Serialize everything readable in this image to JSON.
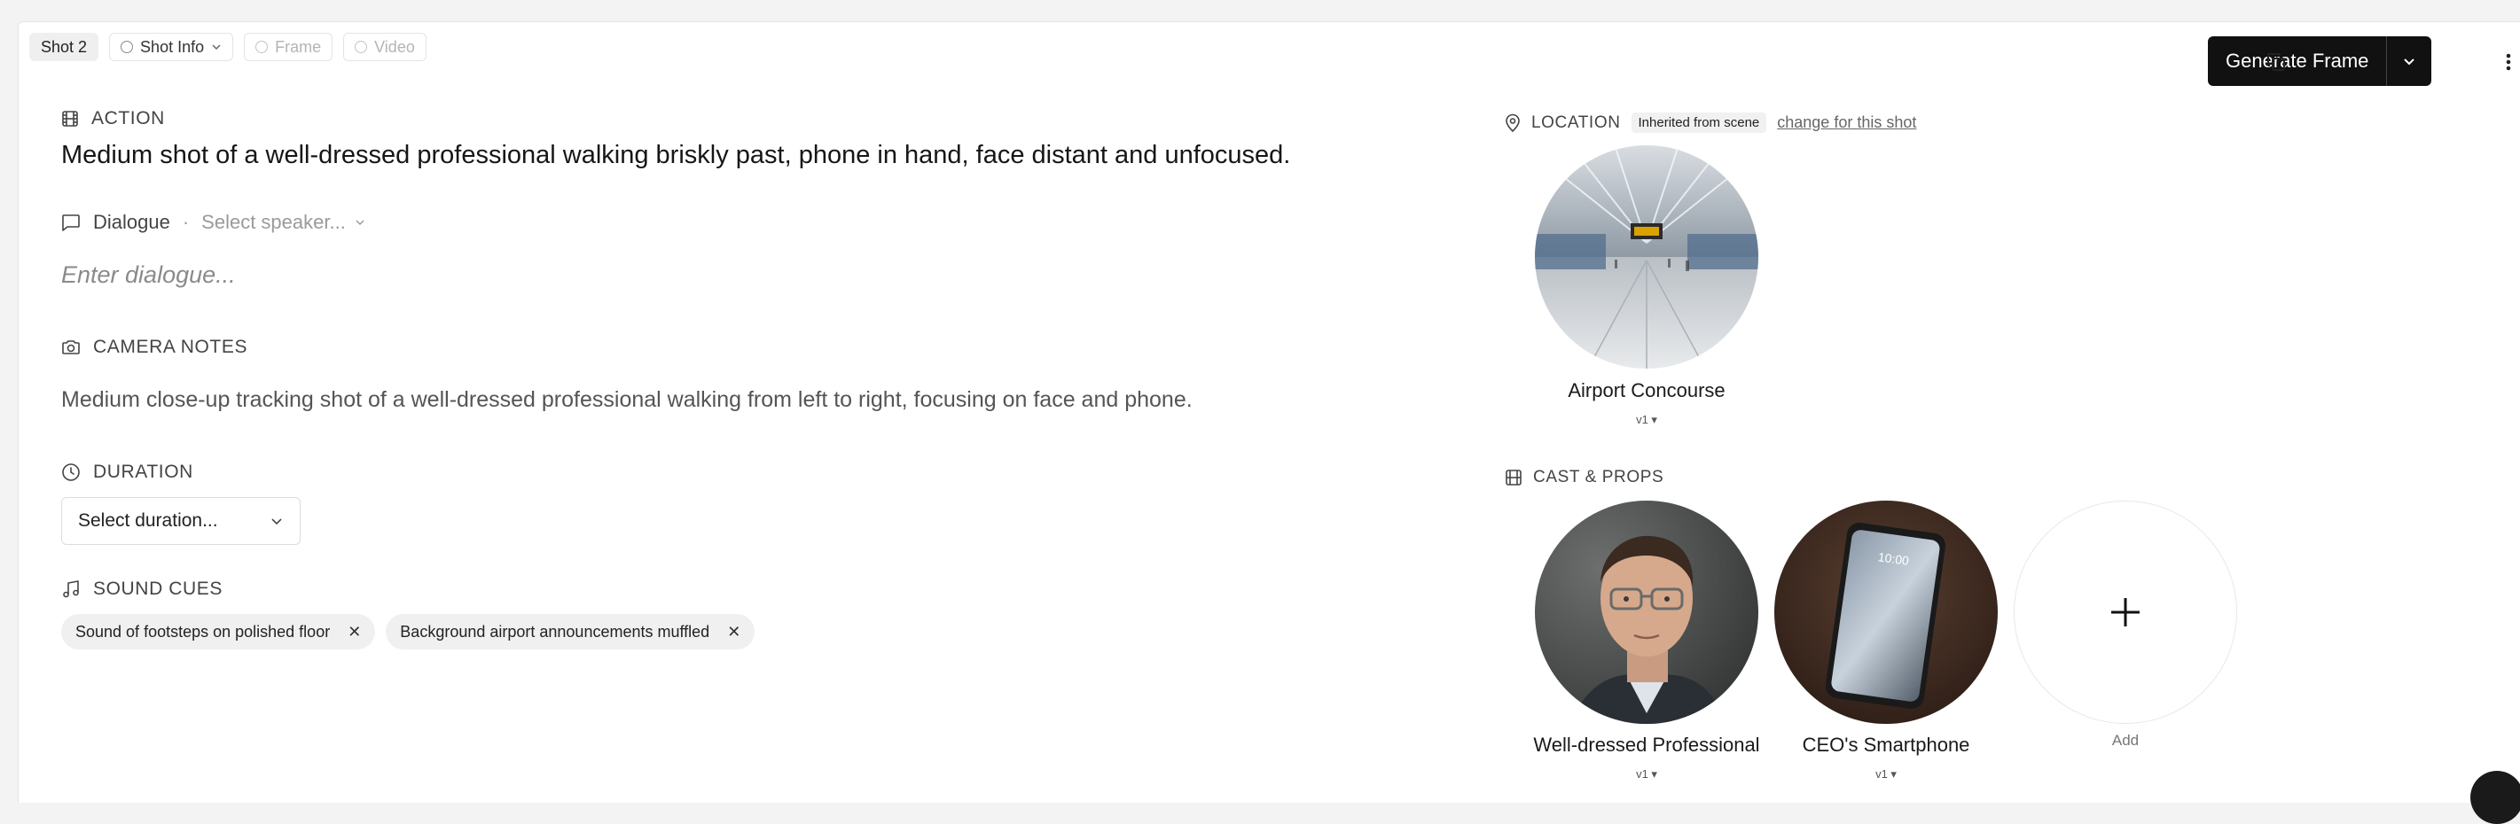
{
  "tabs": [
    {
      "label": "Shot 2",
      "state": "active"
    },
    {
      "label": "Shot Info",
      "state": "normal"
    },
    {
      "label": "Frame",
      "state": "disabled"
    },
    {
      "label": "Video",
      "state": "disabled"
    }
  ],
  "toolbar": {
    "generate_label": "Generate Frame"
  },
  "action": {
    "heading": "ACTION",
    "text": "Medium shot of a well-dressed professional walking briskly past, phone in hand, face distant and unfocused."
  },
  "dialogue": {
    "heading": "Dialogue",
    "separator": "·",
    "speaker_placeholder": "Select speaker...",
    "placeholder": "Enter dialogue..."
  },
  "camera": {
    "heading": "CAMERA NOTES",
    "text": "Medium close-up tracking shot of a well-dressed professional walking from left to right, focusing on face and phone."
  },
  "duration": {
    "heading": "DURATION",
    "placeholder": "Select duration..."
  },
  "sound": {
    "heading": "SOUND CUES",
    "cues": [
      {
        "label": "Sound of footsteps on polished floor"
      },
      {
        "label": "Background airport announcements muffled"
      }
    ]
  },
  "location": {
    "heading": "LOCATION",
    "badge": "Inherited from scene",
    "change_link": "change for this shot",
    "name": "Airport Concourse",
    "version": "v1 ▾"
  },
  "cast": {
    "heading": "CAST & PROPS",
    "items": [
      {
        "name": "Well-dressed Professional",
        "version": "v1 ▾"
      },
      {
        "name": "CEO's Smartphone",
        "version": "v1 ▾"
      }
    ],
    "add_label": "Add"
  }
}
